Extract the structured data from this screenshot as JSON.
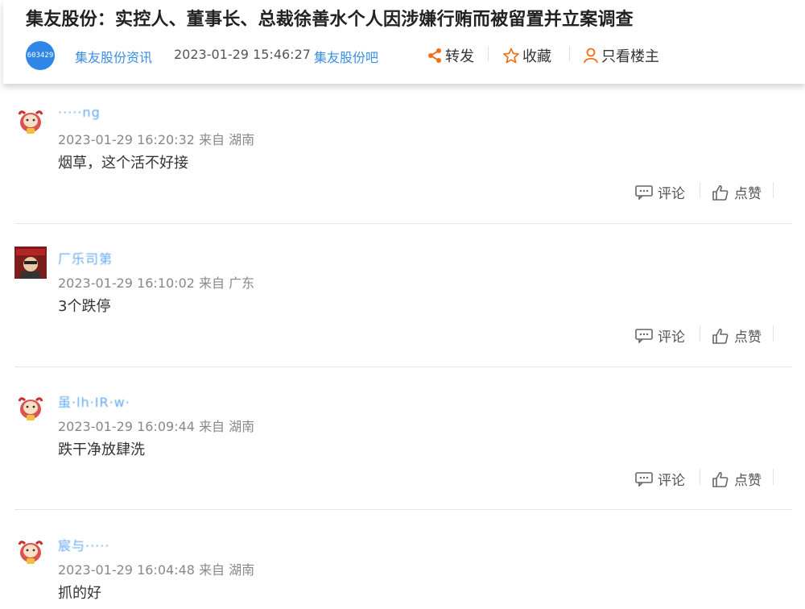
{
  "post": {
    "title": "集友股份：实控人、董事长、总裁徐善水个人因涉嫌行贿而被留置并立案调查",
    "stock_code": "603429",
    "source": "集友股份资讯",
    "time": "2023-01-29 15:46:27",
    "bar": "集友股份吧",
    "actions": {
      "forward": "转发",
      "collect": "收藏",
      "author_only": "只看楼主"
    }
  },
  "colors": {
    "accent": "#3a8ee6",
    "action_icon": "#f0701a",
    "avatar_blue": "#2f86e6"
  },
  "comments": [
    {
      "user": "·····ng",
      "meta": "2023-01-29 16:20:32 来自 湖南",
      "text": "烟草，这个活不好接",
      "avatar": "zodiac-ox-avatar"
    },
    {
      "user": "厂乐司第",
      "meta": "2023-01-29 16:10:02 来自 广东",
      "text": "3个跌停",
      "avatar": "photo-avatar"
    },
    {
      "user": "虽·lh·IR·w·",
      "meta": "2023-01-29 16:09:44 来自 湖南",
      "text": "跌干净放肆洗",
      "avatar": "zodiac-ox-avatar"
    },
    {
      "user": "宸与·····",
      "meta": "2023-01-29 16:04:48 来自 湖南",
      "text": "抓的好",
      "avatar": "zodiac-ox-avatar"
    }
  ],
  "comment_actions": {
    "reply": "评论",
    "like": "点赞"
  }
}
